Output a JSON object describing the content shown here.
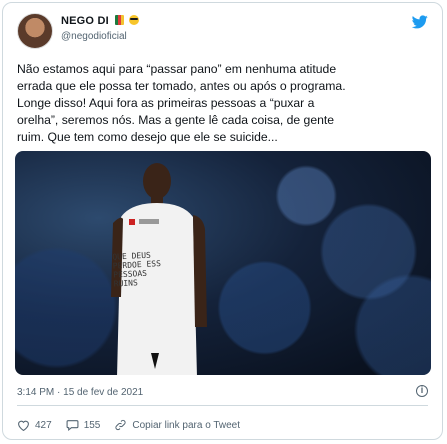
{
  "author": {
    "name": "NEGO DI",
    "handle": "@negodioficial",
    "avatar_icon": "profile-avatar",
    "badges": [
      "brazil-flag-icon",
      "sunglasses-emoji-icon"
    ]
  },
  "platform_icon": "twitter-bird-icon",
  "tweet": {
    "lines": [
      "Não estamos aqui para “passar pano” em nenhuma atitude",
      "errada que ele possa ter tomado, antes ou após o programa.",
      "Longe disso! Aqui fora as primeiras pessoas a “puxar a",
      "orelha”, seremos nós. Mas a gente lê cada coisa, de gente",
      "ruim. Que tem como desejo que ele se suicide..."
    ]
  },
  "media": {
    "shirt_text": [
      "QUE DEUS",
      "PERDOE ESS",
      "PESSOAS",
      "RUINS"
    ]
  },
  "timestamp": "3:14 PM · 15 de fev de 2021",
  "actions": {
    "likes": "427",
    "replies": "155",
    "copy_link": "Copiar link para o Tweet"
  },
  "colors": {
    "twitter_blue": "#1d9bf0",
    "muted_text": "#536471",
    "border": "#cfd9de"
  }
}
